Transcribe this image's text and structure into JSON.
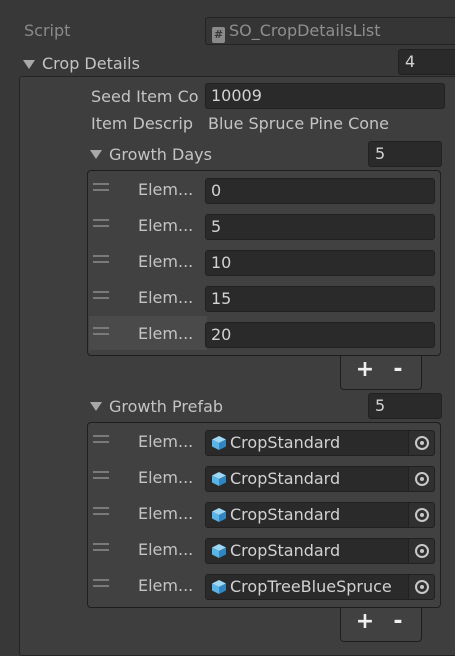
{
  "script": {
    "label": "Script",
    "value": "SO_CropDetailsList",
    "icon": "script-hash-icon"
  },
  "crop_details": {
    "label": "Crop Details",
    "size": "4"
  },
  "seed_item_code": {
    "label": "Seed Item Co",
    "value": "10009"
  },
  "item_description": {
    "label": "Item Descrip",
    "value": "Blue Spruce Pine Cone"
  },
  "growth_days": {
    "label": "Growth Days",
    "size": "5",
    "items": [
      {
        "label": "Elem...",
        "value": "0"
      },
      {
        "label": "Elem...",
        "value": "5"
      },
      {
        "label": "Elem...",
        "value": "10"
      },
      {
        "label": "Elem...",
        "value": "15"
      },
      {
        "label": "Elem...",
        "value": "20"
      }
    ],
    "add_label": "+",
    "remove_label": "-"
  },
  "growth_prefab": {
    "label": "Growth Prefab",
    "size": "5",
    "items": [
      {
        "label": "Elem...",
        "value": "CropStandard"
      },
      {
        "label": "Elem...",
        "value": "CropStandard"
      },
      {
        "label": "Elem...",
        "value": "CropStandard"
      },
      {
        "label": "Elem...",
        "value": "CropStandard"
      },
      {
        "label": "Elem...",
        "value": "CropTreeBlueSpruce"
      }
    ],
    "add_label": "+",
    "remove_label": "-"
  },
  "colors": {
    "background": "#383838",
    "field": "#2a2a2a",
    "prefab_icon": "#5ab4e8"
  }
}
